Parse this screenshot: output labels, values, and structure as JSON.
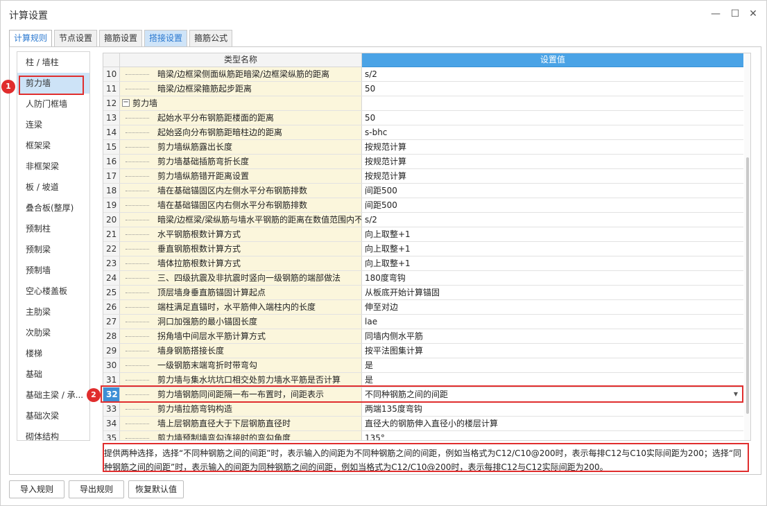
{
  "window": {
    "title": "计算设置",
    "minimize": "—",
    "maximize": "☐",
    "close": "✕"
  },
  "tabs": [
    {
      "label": "计算规则"
    },
    {
      "label": "节点设置"
    },
    {
      "label": "箍筋设置"
    },
    {
      "label": "搭接设置"
    },
    {
      "label": "箍筋公式"
    }
  ],
  "sidebar": {
    "items": [
      "柱 / 墙柱",
      "剪力墙",
      "人防门框墙",
      "连梁",
      "框架梁",
      "非框架梁",
      "板 / 坡道",
      "叠合板(整厚)",
      "预制柱",
      "预制梁",
      "预制墙",
      "空心楼盖板",
      "主肋梁",
      "次肋梁",
      "楼梯",
      "基础",
      "基础主梁 / 承...",
      "基础次梁",
      "砌体结构",
      "其它"
    ],
    "selected": "剪力墙"
  },
  "annotations": {
    "one": "1",
    "two": "2"
  },
  "grid": {
    "col_name": "类型名称",
    "col_value": "设置值",
    "group_toggle": "−",
    "rows": [
      {
        "num": "10",
        "name": "暗梁/边框梁侧面纵筋距暗梁/边框梁纵筋的距离",
        "value": "s/2"
      },
      {
        "num": "11",
        "name": "暗梁/边框梁箍筋起步距离",
        "value": "50"
      },
      {
        "num": "12",
        "name": "剪力墙",
        "value": ""
      },
      {
        "num": "13",
        "name": "起始水平分布钢筋距楼面的距离",
        "value": "50"
      },
      {
        "num": "14",
        "name": "起始竖向分布钢筋距暗柱边的距离",
        "value": "s-bhc"
      },
      {
        "num": "15",
        "name": "剪力墙纵筋露出长度",
        "value": "按规范计算"
      },
      {
        "num": "16",
        "name": "剪力墙基础插筋弯折长度",
        "value": "按规范计算"
      },
      {
        "num": "17",
        "name": "剪力墙纵筋错开距离设置",
        "value": "按规范计算"
      },
      {
        "num": "18",
        "name": "墙在基础锚固区内左侧水平分布钢筋排数",
        "value": "间距500"
      },
      {
        "num": "19",
        "name": "墙在基础锚固区内右侧水平分布钢筋排数",
        "value": "间距500"
      },
      {
        "num": "20",
        "name": "暗梁/边框梁/梁纵筋与墙水平钢筋的距离在数值范围内不...",
        "value": "s/2"
      },
      {
        "num": "21",
        "name": "水平钢筋根数计算方式",
        "value": "向上取整+1"
      },
      {
        "num": "22",
        "name": "垂直钢筋根数计算方式",
        "value": "向上取整+1"
      },
      {
        "num": "23",
        "name": "墙体拉筋根数计算方式",
        "value": "向上取整+1"
      },
      {
        "num": "24",
        "name": "三、四级抗震及非抗震时竖向一级钢筋的端部做法",
        "value": "180度弯钩"
      },
      {
        "num": "25",
        "name": "顶层墙身垂直筋锚固计算起点",
        "value": "从板底开始计算锚固"
      },
      {
        "num": "26",
        "name": "端柱满足直锚时，水平筋伸入端柱内的长度",
        "value": "伸至对边"
      },
      {
        "num": "27",
        "name": "洞口加强筋的最小锚固长度",
        "value": "lae"
      },
      {
        "num": "28",
        "name": "拐角墙中间层水平筋计算方式",
        "value": "同墙内侧水平筋"
      },
      {
        "num": "29",
        "name": "墙身钢筋搭接长度",
        "value": "按平法图集计算"
      },
      {
        "num": "30",
        "name": "一级钢筋末端弯折时带弯勾",
        "value": "是"
      },
      {
        "num": "31",
        "name": "剪力墙与集水坑坑口相交处剪力墙水平筋是否计算",
        "value": "是"
      },
      {
        "num": "32",
        "name": "剪力墙钢筋同间距隔一布一布置时，间距表示",
        "value": "不同种钢筋之间的间距"
      },
      {
        "num": "33",
        "name": "剪力墙拉筋弯钩构造",
        "value": "两端135度弯钩"
      },
      {
        "num": "34",
        "name": "墙上层钢筋直径大于下层钢筋直径时",
        "value": "直径大的钢筋伸入直径小的楼层计算"
      },
      {
        "num": "35",
        "name": "剪力墙预制墙弯勾连接时的弯勾角度",
        "value": "135°"
      }
    ]
  },
  "description": "提供两种选择，选择“不同种钢筋之间的间距”时，表示输入的间距为不同种钢筋之间的间距，例如当格式为C12/C10@200时，表示每排C12与C10实际间距为200；选择“同种钢筋之间的间距”时，表示输入的间距为同种钢筋之间的间距，例如当格式为C12/C10@200时，表示每排C12与C12实际间距为200。",
  "buttons": {
    "import": "导入规则",
    "export": "导出规则",
    "restore": "恢复默认值"
  },
  "icons": {
    "dropdown": "chevron-down-icon"
  }
}
